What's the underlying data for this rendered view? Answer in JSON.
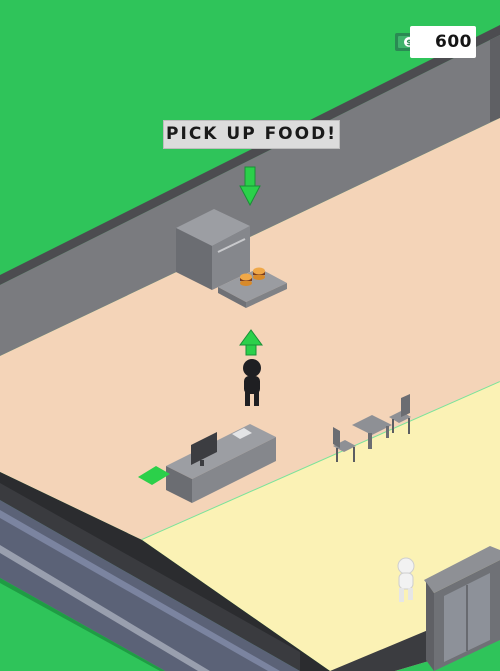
{
  "hud": {
    "money_value": "600",
    "money_icon": "cash-icon"
  },
  "objective": {
    "text": "PICK UP FOOD!"
  },
  "colors": {
    "grass": "#2fc45a",
    "wall": "#7a7b7f",
    "kitchen_floor": "#f4d4b8",
    "dining_floor": "#fbf2b5",
    "road": "#5b6277",
    "arrow_green": "#2bd04a",
    "player": "#1f1f22"
  }
}
